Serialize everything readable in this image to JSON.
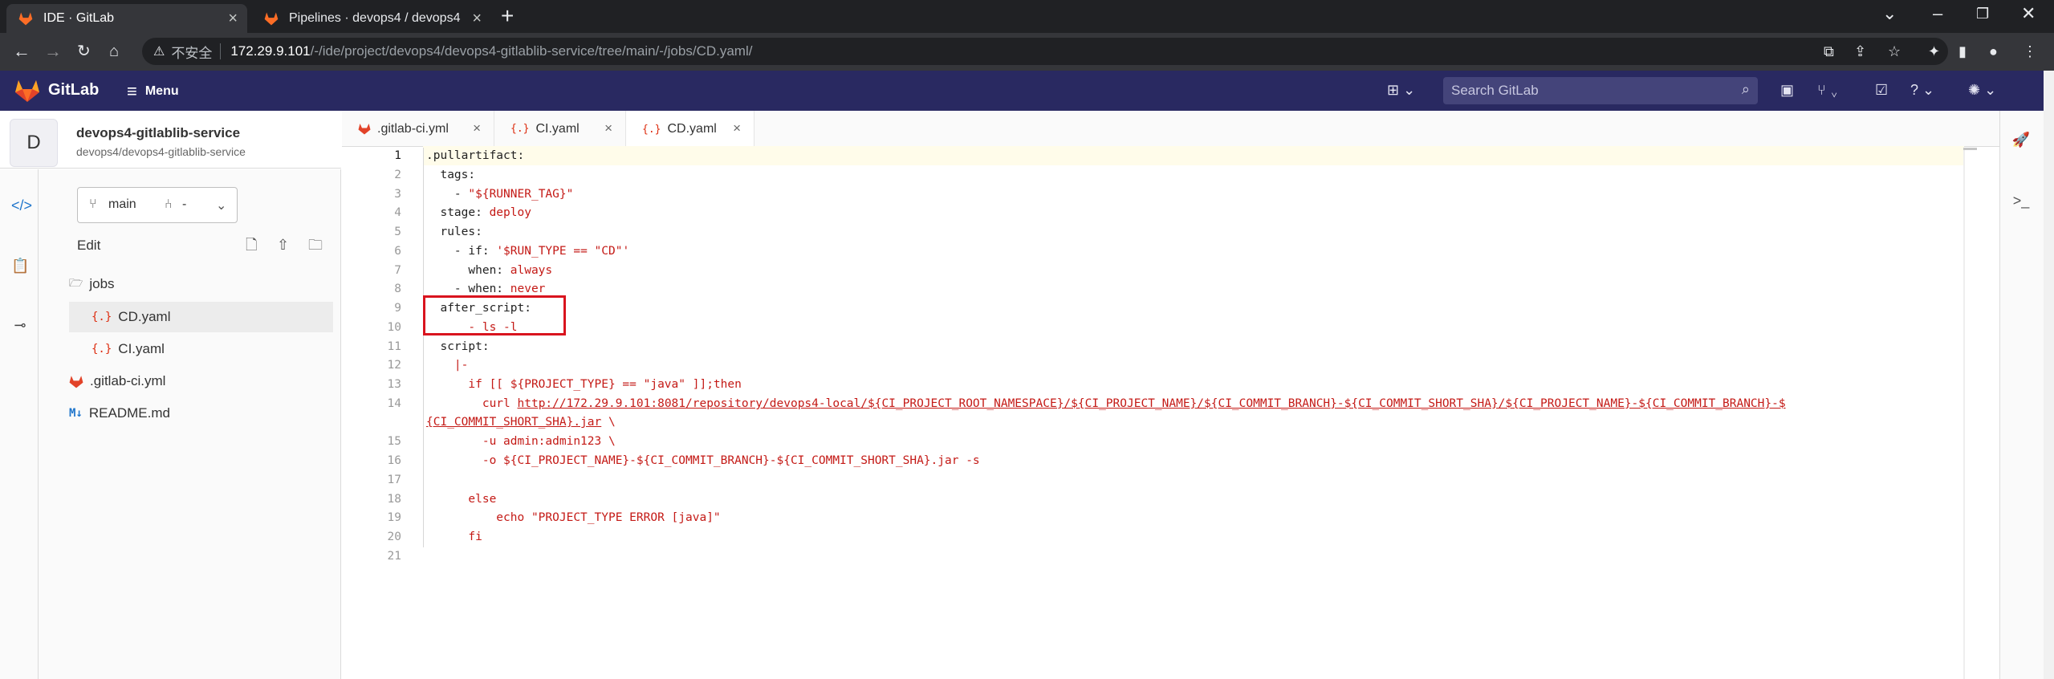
{
  "browser": {
    "tabs": [
      {
        "title": "IDE · GitLab",
        "active": true
      },
      {
        "title": "Pipelines · devops4 / devops4",
        "active": false
      }
    ],
    "new_tab": "+",
    "address": {
      "insecure_label": "不安全",
      "host": "172.29.9.101",
      "path": "/-/ide/project/devops4/devops4-gitlablib-service/tree/main/-/jobs/CD.yaml/"
    }
  },
  "gitlab": {
    "brand": "GitLab",
    "menu_label": "Menu",
    "search_placeholder": "Search GitLab"
  },
  "project": {
    "avatar_letter": "D",
    "name": "devops4-gitlablib-service",
    "path": "devops4/devops4-gitlablib-service"
  },
  "branch": {
    "name": "main",
    "mr": "-"
  },
  "tree": {
    "edit_label": "Edit",
    "items": [
      {
        "label": "jobs",
        "kind": "folder"
      },
      {
        "label": "CD.yaml",
        "kind": "yaml",
        "active": true
      },
      {
        "label": "CI.yaml",
        "kind": "yaml"
      },
      {
        "label": ".gitlab-ci.yml",
        "kind": "gitlab"
      },
      {
        "label": "README.md",
        "kind": "md"
      }
    ]
  },
  "editor_tabs": [
    {
      "label": ".gitlab-ci.yml",
      "kind": "gitlab"
    },
    {
      "label": "CI.yaml",
      "kind": "yaml"
    },
    {
      "label": "CD.yaml",
      "kind": "yaml",
      "active": true
    }
  ],
  "code": {
    "line_numbers": [
      "1",
      "2",
      "3",
      "4",
      "5",
      "6",
      "7",
      "8",
      "9",
      "10",
      "11",
      "12",
      "13",
      "14",
      "",
      "15",
      "16",
      "17",
      "18",
      "19",
      "20",
      "21"
    ],
    "lines": {
      "l1": ".pullartifact:",
      "l2": "  tags:",
      "l3a": "    - ",
      "l3b": "\"${RUNNER_TAG}\"",
      "l4a": "  stage: ",
      "l4b": "deploy",
      "l5": "  rules:",
      "l6a": "    - if: ",
      "l6b": "'$RUN_TYPE == \"CD\"'",
      "l7a": "      when: ",
      "l7b": "always",
      "l8a": "    - when: ",
      "l8b": "never",
      "l9": "  after_script:",
      "l10": "      - ls -l",
      "l11": "  script:",
      "l12": "    |-",
      "l13": "      if [[ ${PROJECT_TYPE} == \"java\" ]];then",
      "l14a": "        curl ",
      "l14b": "http://172.29.9.101:8081/repository/devops4-local/${CI_PROJECT_ROOT_NAMESPACE}/${CI_PROJECT_NAME}/${CI_COMMIT_BRANCH}-${CI_COMMIT_SHORT_SHA}/${CI_PROJECT_NAME}-${CI_COMMIT_BRANCH}-$",
      "l14c": "{CI_COMMIT_SHORT_SHA}.jar",
      "l14d": " \\",
      "l15": "        -u admin:admin123 \\",
      "l16": "        -o ${CI_PROJECT_NAME}-${CI_COMMIT_BRANCH}-${CI_COMMIT_SHORT_SHA}.jar -s",
      "l17": "",
      "l18": "      else",
      "l19": "          echo \"PROJECT_TYPE ERROR [java]\"",
      "l20": "      fi",
      "l21": ""
    }
  },
  "colors": {
    "header": "#292961",
    "accent": "#1f75cb",
    "string": "#c41a16",
    "highlight_box": "#d9141e"
  }
}
